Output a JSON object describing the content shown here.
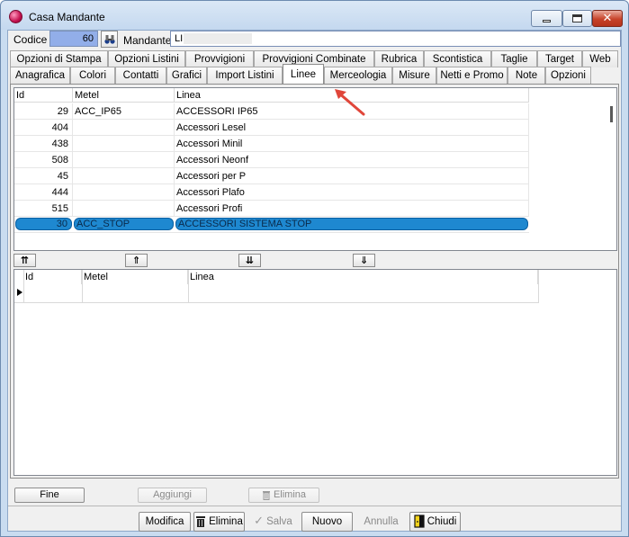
{
  "window": {
    "title": "Casa Mandante"
  },
  "header": {
    "codice_label": "Codice",
    "codice_value": "60",
    "mandante_label": "Mandante",
    "mandante_value": "LI"
  },
  "tabs": {
    "row1": [
      "Opzioni di Stampa",
      "Opzioni Listini",
      "Provvigioni",
      "Provvigioni Combinate",
      "Rubrica",
      "Scontistica",
      "Taglie",
      "Target",
      "Web"
    ],
    "row2": [
      "Anagrafica",
      "Colori",
      "Contatti",
      "Grafici",
      "Import Listini",
      "Linee",
      "Merceologia",
      "Misure",
      "Netti e Promo",
      "Note",
      "Opzioni"
    ],
    "active": "Linee"
  },
  "grid_top": {
    "columns": [
      "Id",
      "Metel",
      "Linea"
    ],
    "rows": [
      {
        "id": "29",
        "metel": "ACC_IP65",
        "linea": "ACCESSORI IP65",
        "selected": false
      },
      {
        "id": "404",
        "metel": "",
        "linea": "Accessori Lesel",
        "selected": false
      },
      {
        "id": "438",
        "metel": "",
        "linea": "Accessori Minil",
        "selected": false
      },
      {
        "id": "508",
        "metel": "",
        "linea": "Accessori Neonf",
        "selected": false
      },
      {
        "id": "45",
        "metel": "",
        "linea": "Accessori per P",
        "selected": false
      },
      {
        "id": "444",
        "metel": "",
        "linea": "Accessori Plafo",
        "selected": false
      },
      {
        "id": "515",
        "metel": "",
        "linea": "Accessori Profi",
        "selected": false
      },
      {
        "id": "30",
        "metel": "ACC_STOP",
        "linea": "ACCESSORI SISTEMA STOP",
        "selected": true
      }
    ]
  },
  "transfer_buttons": {
    "move_all_up": "⇈",
    "move_up": "⇑",
    "move_all_down": "⇊",
    "move_down": "⇓"
  },
  "grid_bottom": {
    "columns": [
      "Id",
      "Metel",
      "Linea"
    ]
  },
  "panel_buttons": {
    "fine": "Fine",
    "aggiungi": "Aggiungi",
    "elimina": "Elimina"
  },
  "bottom_buttons": {
    "modifica": "Modifica",
    "elimina": "Elimina",
    "salva": "Salva",
    "nuovo": "Nuovo",
    "annulla": "Annulla",
    "chiudi": "Chiudi"
  },
  "colors": {
    "selection": "#1e88d0",
    "codice_bg": "#92aee9",
    "annotation_arrow": "#e0463a"
  }
}
